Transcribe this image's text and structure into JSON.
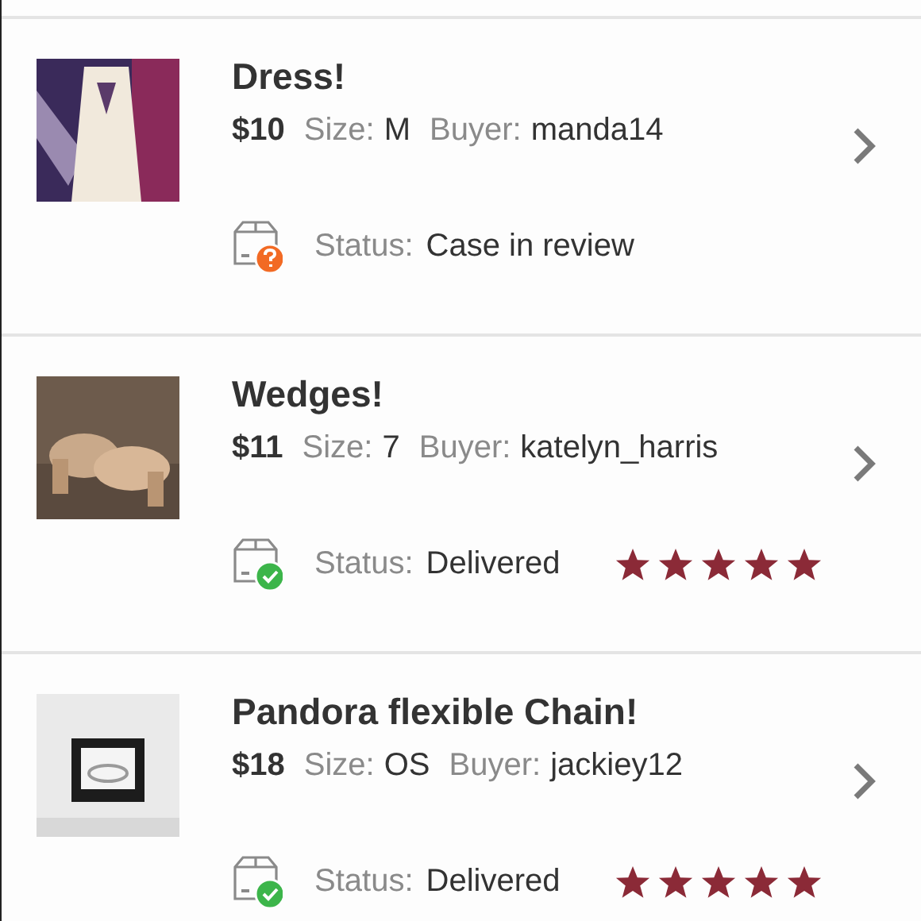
{
  "items": [
    {
      "title": "Dress!",
      "price": "$10",
      "size_label": "Size:",
      "size": "M",
      "buyer_label": "Buyer:",
      "buyer": "manda14",
      "status_label": "Status:",
      "status": "Case in review",
      "kind": "review"
    },
    {
      "title": "Wedges!",
      "price": "$11",
      "size_label": "Size:",
      "size": "7",
      "buyer_label": "Buyer:",
      "buyer": "katelyn_harris",
      "status_label": "Status:",
      "status": "Delivered",
      "kind": "delivered",
      "stars": 5
    },
    {
      "title": "Pandora flexible Chain!",
      "price": "$18",
      "size_label": "Size:",
      "size": "OS",
      "buyer_label": "Buyer:",
      "buyer": "jackiey12",
      "status_label": "Status:",
      "status": "Delivered",
      "kind": "delivered",
      "stars": 5
    }
  ]
}
